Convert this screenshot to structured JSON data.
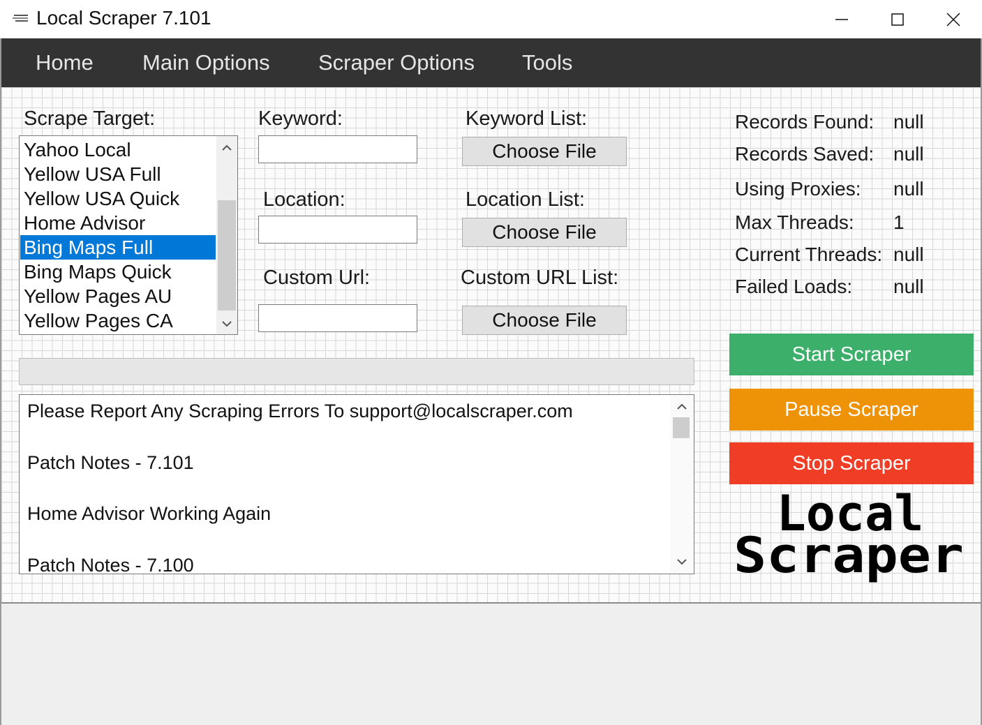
{
  "window": {
    "title": "Local Scraper 7.101",
    "controls": [
      "minimize-icon",
      "maximize-icon",
      "close-icon"
    ]
  },
  "menu": {
    "items": [
      {
        "label": "Home"
      },
      {
        "label": "Main Options"
      },
      {
        "label": "Scraper Options"
      },
      {
        "label": "Tools"
      }
    ]
  },
  "form": {
    "scrape_target_label": "Scrape Target:",
    "scrape_targets": [
      "Yahoo Local",
      "Yellow USA Full",
      "Yellow USA Quick",
      "Home Advisor",
      "Bing Maps Full",
      "Bing Maps Quick",
      "Yellow Pages AU",
      "Yellow Pages CA"
    ],
    "selected_target": "Bing Maps Full",
    "keyword_label": "Keyword:",
    "keyword_value": "",
    "location_label": "Location:",
    "location_value": "",
    "custom_url_label": "Custom Url:",
    "custom_url_value": "",
    "keyword_list_label": "Keyword List:",
    "location_list_label": "Location List:",
    "custom_url_list_label": "Custom URL List:",
    "choose_file_label": "Choose File"
  },
  "progress": {
    "value": 0
  },
  "log": {
    "lines": [
      "Please Report Any Scraping Errors To support@localscraper.com",
      "Patch Notes - 7.101",
      "Home Advisor Working Again",
      "Patch Notes - 7.100"
    ]
  },
  "stats": [
    {
      "label": "Records Found:",
      "value": "null"
    },
    {
      "label": "Records Saved:",
      "value": "null"
    },
    {
      "label": "Using Proxies:",
      "value": "null"
    },
    {
      "label": "Max Threads:",
      "value": "1"
    },
    {
      "label": "Current Threads:",
      "value": "null"
    },
    {
      "label": "Failed Loads:",
      "value": "null"
    }
  ],
  "actions": {
    "start": {
      "label": "Start Scraper",
      "color": "#3cb06a"
    },
    "pause": {
      "label": "Pause Scraper",
      "color": "#ee9208"
    },
    "stop": {
      "label": "Stop Scraper",
      "color": "#ef3d26"
    }
  },
  "logo": {
    "line1": "Local",
    "line2": "Scraper"
  },
  "colors": {
    "menu_bg": "#333333",
    "selection": "#0078d7"
  }
}
